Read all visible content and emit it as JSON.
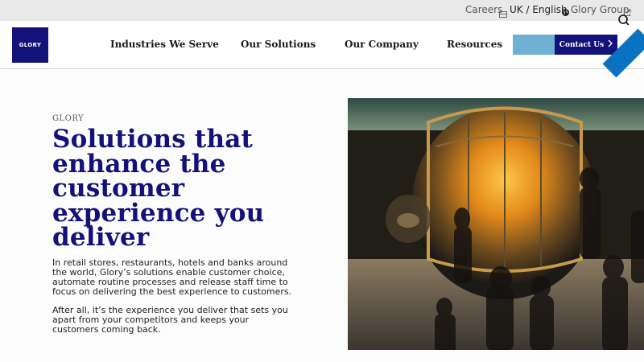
{
  "topbar": {
    "careers": "Careers",
    "language": "UK / English",
    "group": "Glory Group"
  },
  "header": {
    "logo_text": "GLORY",
    "nav": [
      {
        "label": "Industries We Serve"
      },
      {
        "label": "Our Solutions"
      },
      {
        "label": "Our Company"
      },
      {
        "label": "Resources"
      }
    ],
    "contact_label": "Contact Us"
  },
  "hero": {
    "eyebrow": "GLORY",
    "title": "Solutions that enhance the customer experience you deliver",
    "paragraph1": "In retail stores, restaurants, hotels and banks around the world, Glory’s solutions enable customer choice, automate routine processes and release staff time to focus on delivering the best experience to customers.",
    "paragraph2": "After all, it’s the experience you deliver that sets you apart from your competitors and keeps your customers coming back."
  },
  "colors": {
    "brand_navy": "#12127a",
    "accent_blue": "#0a72c0",
    "light_blue": "#6fb1d4"
  }
}
